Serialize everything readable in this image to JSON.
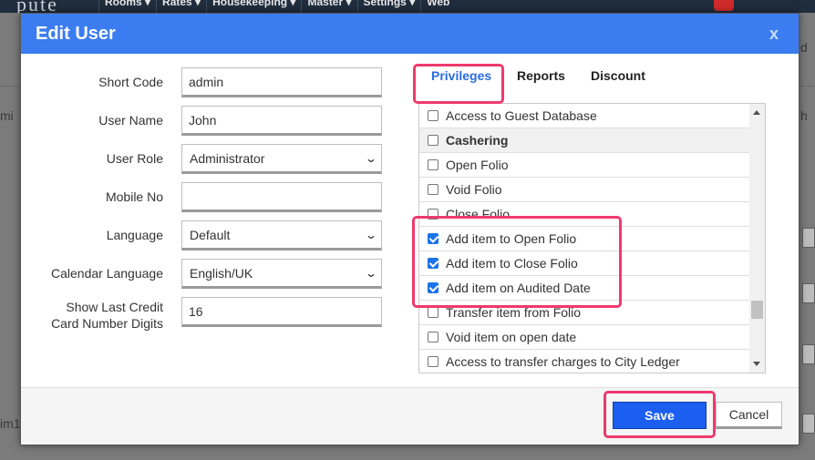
{
  "background": {
    "logo_fragment": "pute",
    "nav": [
      "Rooms ▾",
      "Rates ▾",
      "Housekeeping ▾",
      "Master ▾",
      "Settings ▾",
      "Web"
    ]
  },
  "modal": {
    "title": "Edit User",
    "close_glyph": "x"
  },
  "form": {
    "short_code": {
      "label": "Short Code",
      "value": "admin"
    },
    "user_name": {
      "label": "User Name",
      "value": "John"
    },
    "user_role": {
      "label": "User Role",
      "value": "Administrator"
    },
    "mobile_no": {
      "label": "Mobile No",
      "value": ""
    },
    "language": {
      "label": "Language",
      "value": "Default"
    },
    "calendar_language": {
      "label": "Calendar Language",
      "value": "English/UK"
    },
    "last_digits": {
      "label_line1": "Show Last Credit",
      "label_line2": "Card Number Digits",
      "value": "16"
    }
  },
  "tabs": [
    {
      "label": "Privileges",
      "active": true
    },
    {
      "label": "Reports",
      "active": false
    },
    {
      "label": "Discount",
      "active": false
    }
  ],
  "privileges": [
    {
      "label": "Access to Guest Database",
      "checked": false,
      "group": false
    },
    {
      "label": "Cashering",
      "checked": false,
      "group": true
    },
    {
      "label": "Open Folio",
      "checked": false,
      "group": false
    },
    {
      "label": "Void Folio",
      "checked": false,
      "group": false
    },
    {
      "label": "Close Folio",
      "checked": false,
      "group": false
    },
    {
      "label": "Add item to Open Folio",
      "checked": true,
      "group": false
    },
    {
      "label": "Add item to Close Folio",
      "checked": true,
      "group": false
    },
    {
      "label": "Add item on Audited Date",
      "checked": true,
      "group": false
    },
    {
      "label": "Transfer item from Folio",
      "checked": false,
      "group": false
    },
    {
      "label": "Void item on open date",
      "checked": false,
      "group": false
    },
    {
      "label": "Access to transfer charges to City Ledger",
      "checked": false,
      "group": false
    }
  ],
  "footer": {
    "save_label": "Save",
    "cancel_label": "Cancel"
  },
  "colors": {
    "header": "#3b7df0",
    "save_button": "#1c5ef0",
    "highlight": "#ee3a6e",
    "checkbox_checked": "#1a73e8"
  }
}
